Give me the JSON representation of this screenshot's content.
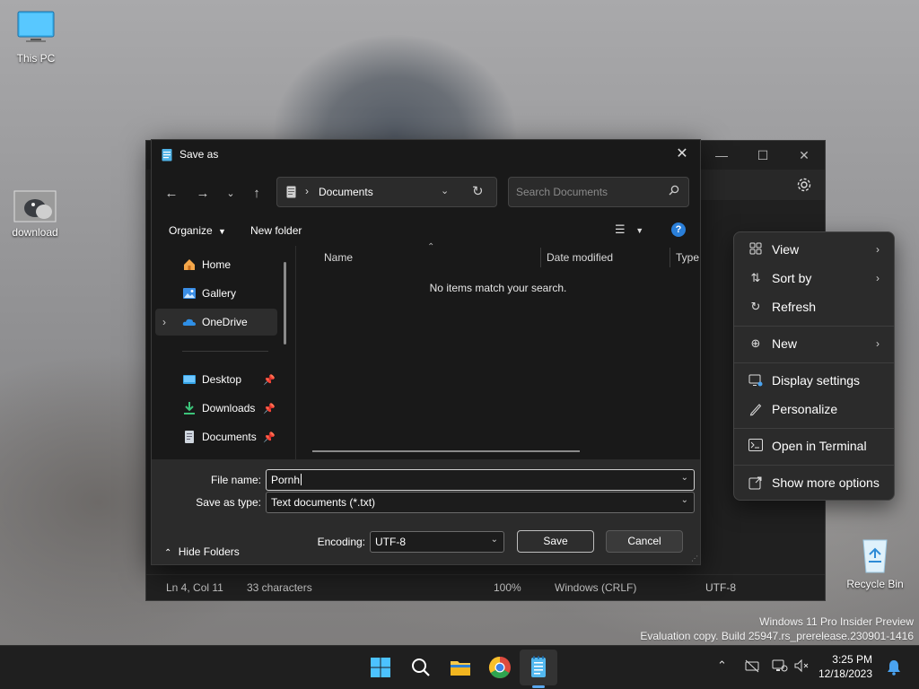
{
  "desktop": {
    "icons": [
      {
        "label": "This PC"
      },
      {
        "label": "download"
      },
      {
        "label": "Recycle Bin"
      }
    ],
    "watermark": {
      "line1": "Windows 11 Pro Insider Preview",
      "line2": "Evaluation copy. Build 25947.rs_prerelease.230901-1416"
    }
  },
  "notepad": {
    "controls": {
      "minimize": "—",
      "maximize": "☐",
      "close": "✕"
    },
    "status": {
      "position": "Ln 4, Col 11",
      "characters": "33 characters",
      "zoom": "100%",
      "line_ending": "Windows (CRLF)",
      "encoding": "UTF-8"
    }
  },
  "dialog": {
    "title": "Save as",
    "address": {
      "crumb": "Documents"
    },
    "search": {
      "placeholder": "Search Documents"
    },
    "commands": {
      "organize": "Organize",
      "new_folder": "New folder"
    },
    "nav": [
      {
        "label": "Home"
      },
      {
        "label": "Gallery"
      },
      {
        "label": "OneDrive"
      },
      {
        "label": "Desktop"
      },
      {
        "label": "Downloads"
      },
      {
        "label": "Documents"
      }
    ],
    "columns": {
      "name": "Name",
      "date_modified": "Date modified",
      "type": "Type"
    },
    "empty_message": "No items match your search.",
    "file_name": {
      "label": "File name:",
      "value": "Pornh"
    },
    "save_as_type": {
      "label": "Save as type:",
      "value": "Text documents (*.txt)"
    },
    "encoding": {
      "label": "Encoding:",
      "value": "UTF-8"
    },
    "hide_folders": "Hide Folders",
    "save_button": "Save",
    "cancel_button": "Cancel"
  },
  "context_menu": {
    "items": [
      {
        "label": "View",
        "icon": "grid-icon",
        "submenu": true
      },
      {
        "label": "Sort by",
        "icon": "sort-icon",
        "submenu": true
      },
      {
        "label": "Refresh",
        "icon": "refresh-icon",
        "submenu": false
      },
      {
        "label": "New",
        "icon": "plus-circle-icon",
        "submenu": true
      },
      {
        "label": "Display settings",
        "icon": "display-settings-icon",
        "submenu": false
      },
      {
        "label": "Personalize",
        "icon": "pen-icon",
        "submenu": false
      },
      {
        "label": "Open in Terminal",
        "icon": "terminal-icon",
        "submenu": false
      },
      {
        "label": "Show more options",
        "icon": "share-icon",
        "submenu": false
      }
    ]
  },
  "taskbar": {
    "time": "3:25 PM",
    "date": "12/18/2023"
  },
  "colors": {
    "accent": "#5aa8f0",
    "dialog_bg": "#191919",
    "taskbar_bg": "#1f1f1f"
  }
}
